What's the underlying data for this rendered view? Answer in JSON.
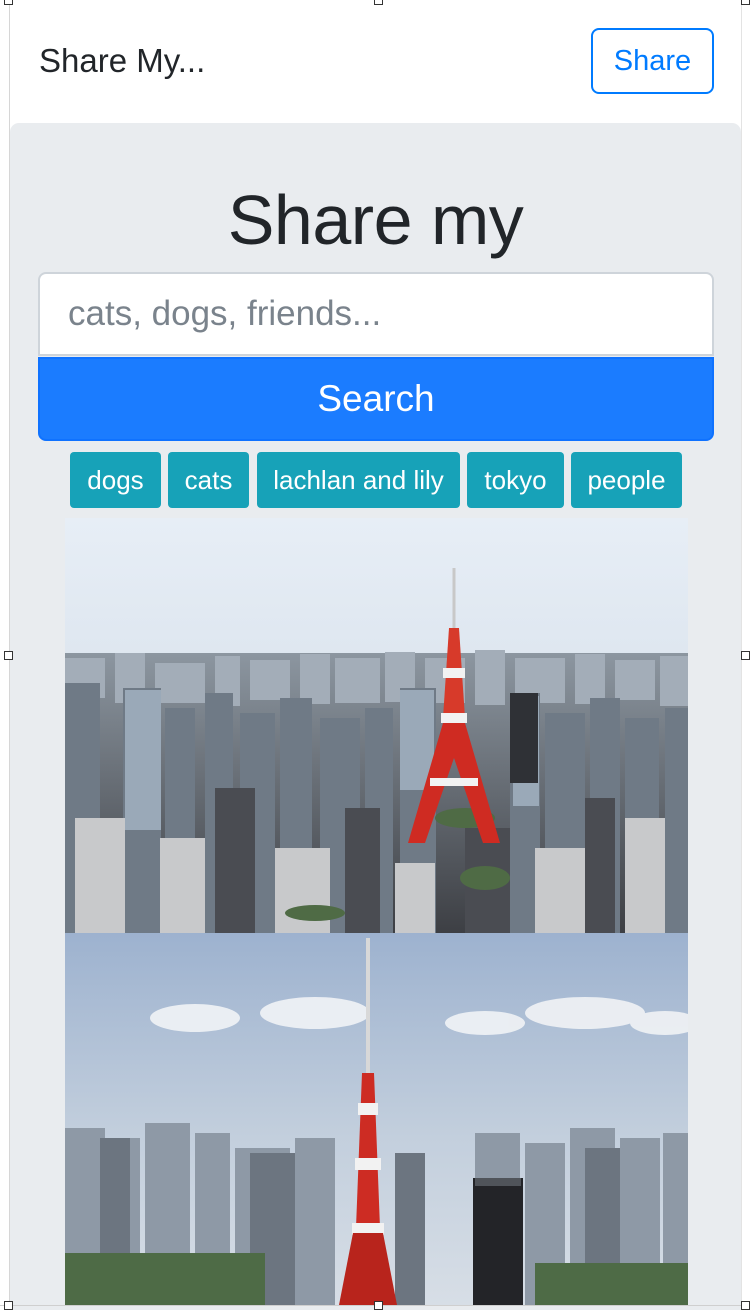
{
  "navbar": {
    "brand": "Share My...",
    "share_label": "Share"
  },
  "hero": {
    "title": "Share my"
  },
  "search": {
    "placeholder": "cats, dogs, friends...",
    "button_label": "Search"
  },
  "tags": [
    "dogs",
    "cats",
    "lachlan and lily",
    "tokyo",
    "people"
  ],
  "colors": {
    "primary": "#1b7cff",
    "info": "#17a2b8",
    "jumbotron_bg": "#e9ecef"
  },
  "photos": [
    {
      "subject": "tokyo-skyline-photo"
    },
    {
      "subject": "tokyo-tower-photo"
    }
  ]
}
